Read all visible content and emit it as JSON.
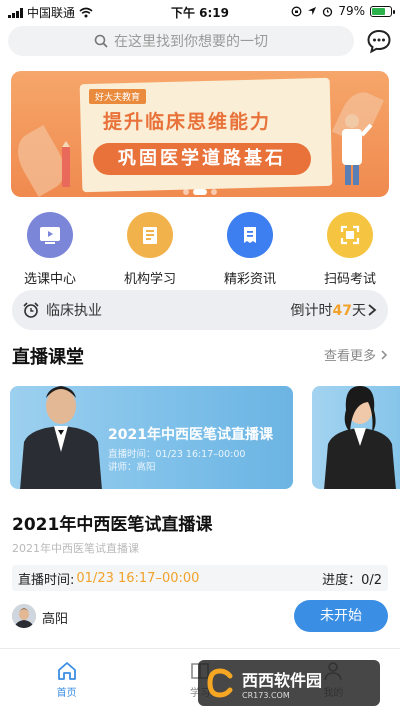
{
  "status_bar": {
    "carrier": "中国联通",
    "time": "下午 6:19",
    "battery": "79%",
    "battery_level": 0.79
  },
  "search": {
    "placeholder": "在这里找到你想要的一切"
  },
  "banner": {
    "tag": "好大夫教育",
    "line1": "提升临床思维能力",
    "line2": "巩固医学道路基石",
    "slide_count": 3,
    "active_slide": 1
  },
  "quick_menu": [
    {
      "label": "选课中心",
      "icon": "play-video-icon",
      "color": "#7c86d8"
    },
    {
      "label": "机构学习",
      "icon": "books-icon",
      "color": "#f2b24b"
    },
    {
      "label": "精彩资讯",
      "icon": "news-icon",
      "color": "#3d7ef0"
    },
    {
      "label": "扫码考试",
      "icon": "scan-icon",
      "color": "#f5c542"
    }
  ],
  "exam_countdown": {
    "name": "临床执业",
    "prefix": "倒计时",
    "days": "47",
    "unit": "天"
  },
  "live_section": {
    "title": "直播课堂",
    "see_more": "查看更多"
  },
  "live_card": {
    "title": "2021年中西医笔试直播课",
    "time": "直播时间：01/23 16:17–00:00",
    "teacher": "讲师：高阳"
  },
  "course": {
    "title": "2021年中西医笔试直播课",
    "subtitle": "2021年中西医笔试直播课",
    "time_label": "直播时间:",
    "time_value": "01/23 16:17–00:00",
    "progress": "进度：0/2",
    "teacher_name": "高阳",
    "status_button": "未开始"
  },
  "tabbar": {
    "tabs": [
      {
        "label": "首页",
        "icon": "home-icon",
        "active": true
      },
      {
        "label": "学习",
        "icon": "book-icon",
        "active": false
      },
      {
        "label": "我的",
        "icon": "user-icon",
        "active": false
      }
    ]
  },
  "watermark": {
    "text": "西西软件园",
    "sub": "CR173.COM"
  },
  "colors": {
    "accent": "#3a8ee3",
    "highlight": "#f2a22a",
    "banner": "#f08a4f"
  }
}
